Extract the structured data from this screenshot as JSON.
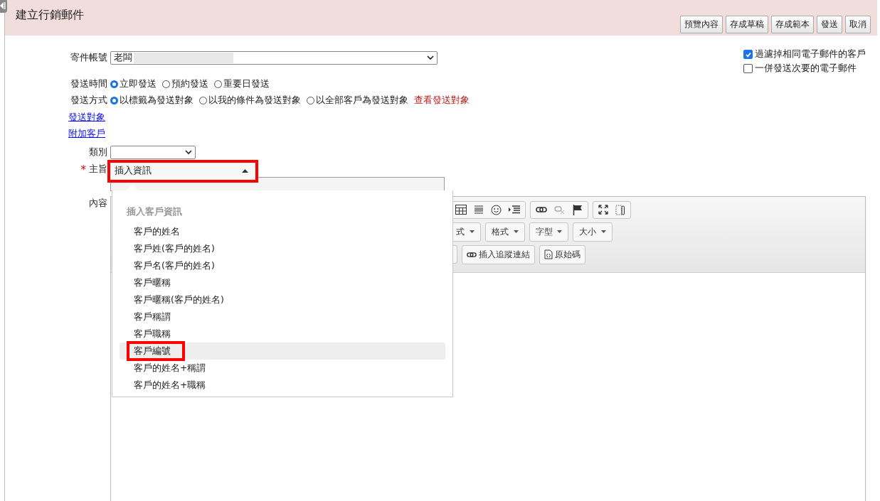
{
  "header": {
    "title": "建立行銷郵件",
    "buttons": [
      "預覽內容",
      "存成草稿",
      "存成範本",
      "發送",
      "取消"
    ]
  },
  "options": [
    {
      "label": "過濾掉相同電子郵件的客戶",
      "checked": true
    },
    {
      "label": "一併發送次要的電子郵件",
      "checked": false
    }
  ],
  "form": {
    "sender": {
      "label": "寄件帳號",
      "value": "老闆"
    },
    "send_time": {
      "label": "發送時間",
      "options": [
        {
          "label": "立即發送",
          "selected": true
        },
        {
          "label": "預約發送",
          "selected": false
        },
        {
          "label": "重要日發送",
          "selected": false
        }
      ]
    },
    "send_method": {
      "label": "發送方式",
      "options": [
        {
          "label": "以標籤為發送對象",
          "selected": true
        },
        {
          "label": "以我的條件為發送對象",
          "selected": false
        },
        {
          "label": "以全部客戶為發送對象",
          "selected": false
        }
      ],
      "link": "查看發送對象"
    },
    "links": [
      "發送對象",
      "附加客戶"
    ],
    "category": {
      "label": "類別"
    },
    "subject": {
      "label": "主旨",
      "required_mark": "*",
      "value": "插入資訊"
    },
    "content": {
      "label": "內容"
    }
  },
  "editor": {
    "dropdowns": [
      "式",
      "格式",
      "字型",
      "大小"
    ],
    "buttons": [
      {
        "label": "插入追蹤連結",
        "kind": "link"
      },
      {
        "label": "原始碼",
        "kind": "source"
      }
    ]
  },
  "insert_menu": {
    "heading": "插入客戶資訊",
    "items": [
      {
        "label": "客戶的姓名",
        "selected": false
      },
      {
        "label": "客戶姓(客戶的姓名)",
        "selected": false
      },
      {
        "label": "客戶名(客戶的姓名)",
        "selected": false
      },
      {
        "label": "客戶暱稱",
        "selected": false
      },
      {
        "label": "客戶暱稱(客戶的姓名)",
        "selected": false
      },
      {
        "label": "客戶稱謂",
        "selected": false
      },
      {
        "label": "客戶職稱",
        "selected": false
      },
      {
        "label": "客戶編號",
        "selected": true
      },
      {
        "label": "客戶的姓名+稱謂",
        "selected": false
      },
      {
        "label": "客戶的姓名+職稱",
        "selected": false
      }
    ]
  }
}
